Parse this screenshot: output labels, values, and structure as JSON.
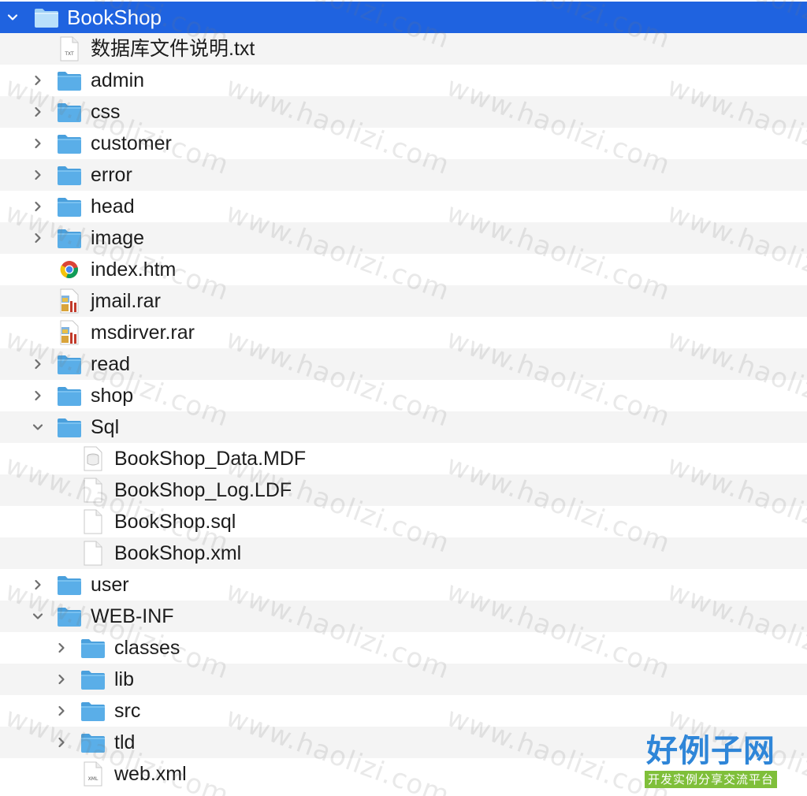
{
  "tree": {
    "rows": [
      {
        "label": "BookShop",
        "type": "folder",
        "depth": 0,
        "expanded": true,
        "selected": true
      },
      {
        "label": "数据库文件说明.txt",
        "type": "txt",
        "depth": 1
      },
      {
        "label": "admin",
        "type": "folder",
        "depth": 1,
        "expanded": false
      },
      {
        "label": "css",
        "type": "folder",
        "depth": 1,
        "expanded": false
      },
      {
        "label": "customer",
        "type": "folder",
        "depth": 1,
        "expanded": false
      },
      {
        "label": "error",
        "type": "folder",
        "depth": 1,
        "expanded": false
      },
      {
        "label": "head",
        "type": "folder",
        "depth": 1,
        "expanded": false
      },
      {
        "label": "image",
        "type": "folder",
        "depth": 1,
        "expanded": false
      },
      {
        "label": "index.htm",
        "type": "chrome",
        "depth": 1
      },
      {
        "label": "jmail.rar",
        "type": "rar",
        "depth": 1
      },
      {
        "label": "msdirver.rar",
        "type": "rar",
        "depth": 1
      },
      {
        "label": "read",
        "type": "folder",
        "depth": 1,
        "expanded": false
      },
      {
        "label": "shop",
        "type": "folder",
        "depth": 1,
        "expanded": false
      },
      {
        "label": "Sql",
        "type": "folder",
        "depth": 1,
        "expanded": true
      },
      {
        "label": "BookShop_Data.MDF",
        "type": "db",
        "depth": 2
      },
      {
        "label": "BookShop_Log.LDF",
        "type": "doc",
        "depth": 2
      },
      {
        "label": "BookShop.sql",
        "type": "doc",
        "depth": 2
      },
      {
        "label": "BookShop.xml",
        "type": "doc",
        "depth": 2
      },
      {
        "label": "user",
        "type": "folder",
        "depth": 1,
        "expanded": false
      },
      {
        "label": "WEB-INF",
        "type": "folder",
        "depth": 1,
        "expanded": true
      },
      {
        "label": "classes",
        "type": "folder",
        "depth": 2,
        "expanded": false
      },
      {
        "label": "lib",
        "type": "folder",
        "depth": 2,
        "expanded": false
      },
      {
        "label": "src",
        "type": "folder",
        "depth": 2,
        "expanded": false
      },
      {
        "label": "tld",
        "type": "folder",
        "depth": 2,
        "expanded": false
      },
      {
        "label": "web.xml",
        "type": "xml",
        "depth": 2
      }
    ]
  },
  "icon_labels": {
    "txt": "TXT",
    "xml": "XML"
  },
  "watermark": {
    "text": "www.haolizi.com"
  },
  "logo": {
    "main": "好例子网",
    "sub": "开发实例分享交流平台"
  },
  "colors": {
    "selection": "#1f63e0",
    "folder": "#5aaee8",
    "stripe": "#f4f4f4"
  }
}
